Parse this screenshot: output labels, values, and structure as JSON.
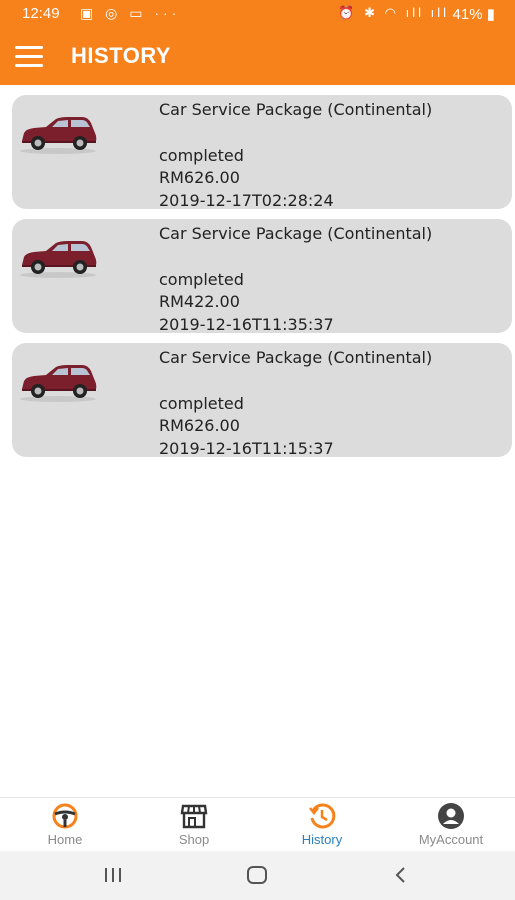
{
  "status_bar": {
    "time": "12:49",
    "left_icons": "▣ ◎ ▭ ···",
    "right_icons": "⏰ ✱ ◠ ıll ıll",
    "battery": "41%"
  },
  "app_bar": {
    "title": "HISTORY",
    "menu_icon": "hamburger-menu-icon"
  },
  "history": [
    {
      "title": "Car Service Package (Continental)",
      "status": "completed",
      "amount": "RM626.00",
      "datetime": "2019-12-17T02:28:24"
    },
    {
      "title": "Car Service Package (Continental)",
      "status": "completed",
      "amount": "RM422.00",
      "datetime": "2019-12-16T11:35:37"
    },
    {
      "title": "Car Service Package (Continental)",
      "status": "completed",
      "amount": "RM626.00",
      "datetime": "2019-12-16T11:15:37"
    }
  ],
  "bottom_nav": {
    "items": [
      {
        "label": "Home",
        "icon": "steering-wheel-icon"
      },
      {
        "label": "Shop",
        "icon": "shop-icon"
      },
      {
        "label": "History",
        "icon": "history-icon",
        "active": true
      },
      {
        "label": "MyAccount",
        "icon": "account-icon"
      }
    ]
  },
  "colors": {
    "brand": "#f7821b",
    "card": "#dcdcdc",
    "active_nav": "#2c7fb8",
    "car_body": "#7a1f2b"
  }
}
